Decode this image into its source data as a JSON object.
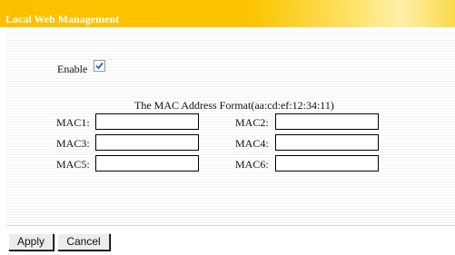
{
  "header": {
    "title": "Local Web Management"
  },
  "form": {
    "enable_label": "Enable",
    "enable_checked": true,
    "format_note": "The MAC Address Format(aa:cd:ef:12:34:11)",
    "mac_fields": [
      {
        "label": "MAC1:",
        "value": ""
      },
      {
        "label": "MAC2:",
        "value": ""
      },
      {
        "label": "MAC3:",
        "value": ""
      },
      {
        "label": "MAC4:",
        "value": ""
      },
      {
        "label": "MAC5:",
        "value": ""
      },
      {
        "label": "MAC6:",
        "value": ""
      }
    ]
  },
  "buttons": {
    "apply_label": "Apply",
    "cancel_label": "Cancel"
  },
  "colors": {
    "header_accent": "#fcc000",
    "checkbox_border": "#7f9db9",
    "checkmark": "#2f5fb0"
  }
}
